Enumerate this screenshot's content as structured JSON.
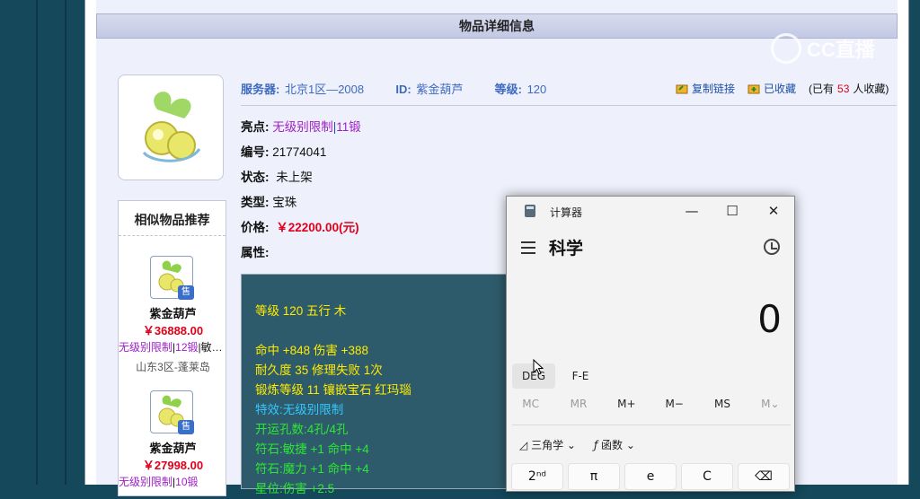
{
  "page": {
    "title": "物品详细信息"
  },
  "watermark": {
    "text": "CC直播"
  },
  "meta": {
    "server_label": "服务器:",
    "server_value": "北京1区—2008",
    "id_label": "ID:",
    "id_value": "紫金葫芦",
    "level_label": "等级:",
    "level_value": "120"
  },
  "actions": {
    "copy_link": "复制链接",
    "collected": "已收藏",
    "collect_count_prefix": "(已有",
    "collect_count": "53",
    "collect_count_suffix": "人收藏)"
  },
  "info": {
    "highlight_label": "亮点:",
    "highlight_value_1": "无级别限制",
    "highlight_sep": "|",
    "highlight_value_2": "11锻",
    "number_label": "编号:",
    "number_value": "21774041",
    "status_label": "状态:",
    "status_value": "未上架",
    "type_label": "类型:",
    "type_value": "宝珠",
    "price_label": "价格:",
    "price_value": "￥22200.00(元)",
    "attr_label": "属性:"
  },
  "stats": [
    {
      "text": "等级 120 五行 木",
      "color": "yellow"
    },
    {
      "text": "",
      "color": "yellow"
    },
    {
      "text": "命中 +848 伤害 +388",
      "color": "yellow"
    },
    {
      "text": "耐久度 35 修理失败 1次",
      "color": "yellow"
    },
    {
      "text": "锻炼等级 11 镶嵌宝石 红玛瑙",
      "color": "yellow"
    },
    {
      "text": "特效:无级别限制",
      "color": "cyan"
    },
    {
      "text": "开运孔数:4孔/4孔",
      "color": "green"
    },
    {
      "text": "符石:敏捷 +1 命中 +4",
      "color": "green"
    },
    {
      "text": "符石:魔力 +1 命中 +4",
      "color": "green"
    },
    {
      "text": "星位:伤害 +2.5",
      "color": "green"
    }
  ],
  "recommend": {
    "header": "相似物品推荐",
    "items": [
      {
        "badge": "售",
        "name": "紫金葫芦",
        "price": "￥36888.00",
        "tag1": "无级别限制",
        "tag2": "12锻",
        "tag3": "敏…",
        "server": "山东3区-蓬莱岛"
      },
      {
        "badge": "售",
        "name": "紫金葫芦",
        "price": "￥27998.00",
        "tag1": "无级别限制",
        "tag2": "10锻",
        "tag3": "",
        "server": ""
      }
    ]
  },
  "calculator": {
    "app_title": "计算器",
    "minimize": "—",
    "maximize": "☐",
    "close": "✕",
    "mode": "科学",
    "display": "0",
    "angle_mode": "DEG",
    "fe": "F-E",
    "memory": [
      "MC",
      "MR",
      "M+",
      "M−",
      "MS",
      "M⌄"
    ],
    "trig_label": "三角学",
    "func_label": "函数",
    "keys": [
      "2ⁿᵈ",
      "π",
      "e",
      "C",
      "⌫"
    ]
  }
}
